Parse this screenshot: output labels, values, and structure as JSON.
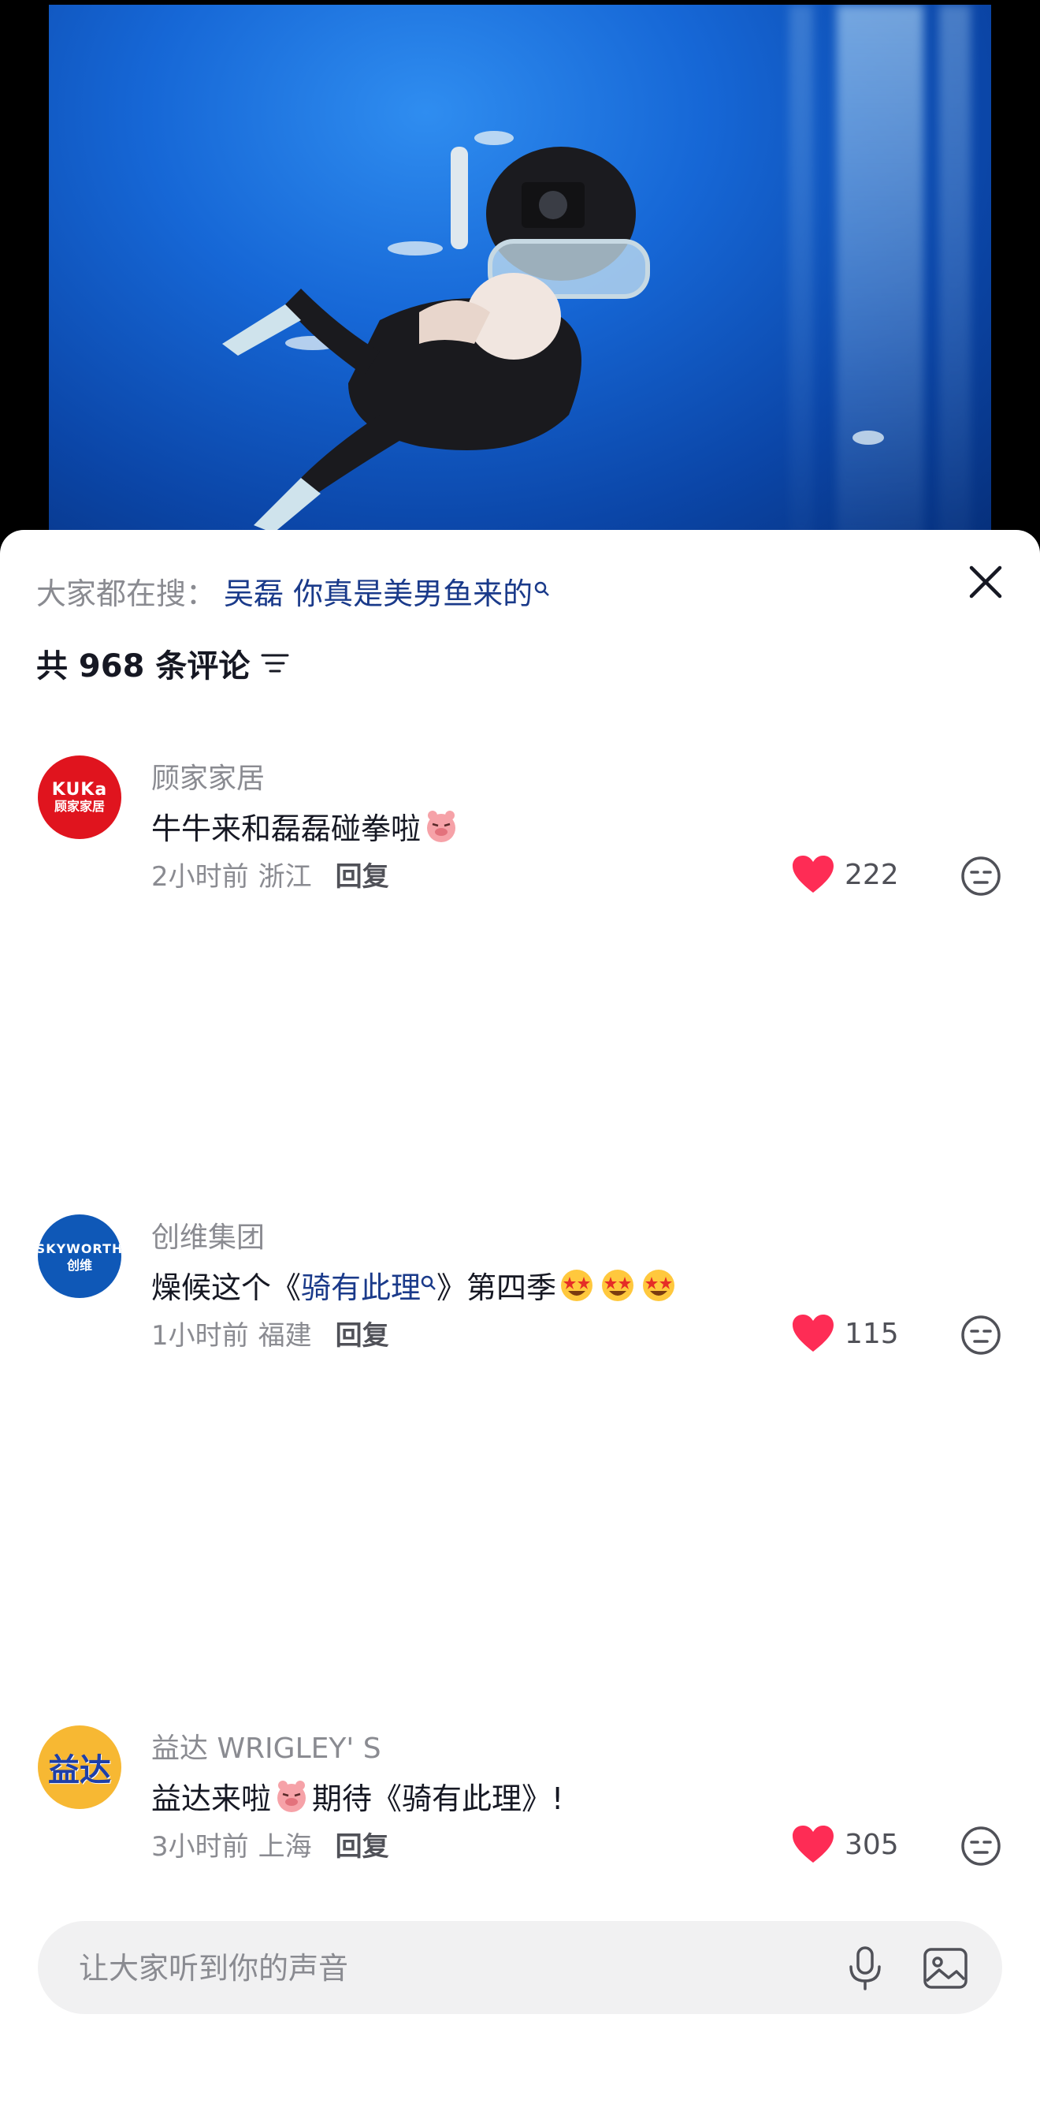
{
  "search_hint": {
    "prefix": "大家都在搜：",
    "keyword": "吴磊 你真是美男鱼来的",
    "search_icon": "search-icon"
  },
  "comment_count_label": "共 968 条评论",
  "comments": [
    {
      "user": "顾家家居",
      "avatar_line1": "KUKa",
      "avatar_line2": "顾家家居",
      "text": "牛牛来和磊磊碰拳啦",
      "time": "2小时前",
      "location": "浙江",
      "reply": "回复",
      "likes": "222"
    },
    {
      "user": "创维集团",
      "avatar_line1": "SKYWORTH",
      "avatar_line2": "创维",
      "text_before": "燥候这个《",
      "text_link": "骑有此理",
      "text_after": "》第四季",
      "time": "1小时前",
      "location": "福建",
      "reply": "回复",
      "likes": "115"
    },
    {
      "user": "益达 WRIGLEY' S",
      "avatar_line1": "益达",
      "text_before": "益达来啦",
      "text_after": "期待《骑有此理》!",
      "time": "3小时前",
      "location": "上海",
      "reply": "回复",
      "likes": "305"
    }
  ],
  "input": {
    "placeholder": "让大家听到你的声音"
  },
  "colors": {
    "like_red": "#fe2c55",
    "link_blue": "#1a3a8a",
    "muted_gray": "#8a8b91"
  },
  "icons": {
    "close": "close-icon",
    "sort": "sort-icon",
    "like": "heart-icon",
    "dislike": "neutral-face-icon",
    "mic": "microphone-icon",
    "image": "image-icon"
  }
}
